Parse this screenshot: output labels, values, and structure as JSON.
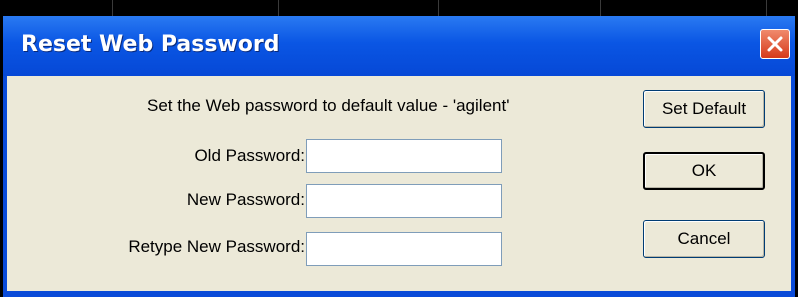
{
  "window": {
    "title": "Reset Web Password"
  },
  "dialog": {
    "instruction": "Set the Web password to default value - 'agilent'",
    "fields": [
      {
        "label": "Old Password:",
        "value": ""
      },
      {
        "label": "New Password:",
        "value": ""
      },
      {
        "label": "Retype New Password:",
        "value": ""
      }
    ],
    "buttons": {
      "set_default": "Set Default",
      "ok": "OK",
      "cancel": "Cancel"
    }
  },
  "colors": {
    "titlebar": "#0a56e4",
    "client": "#ece9d8",
    "close": "#d63a1a"
  }
}
